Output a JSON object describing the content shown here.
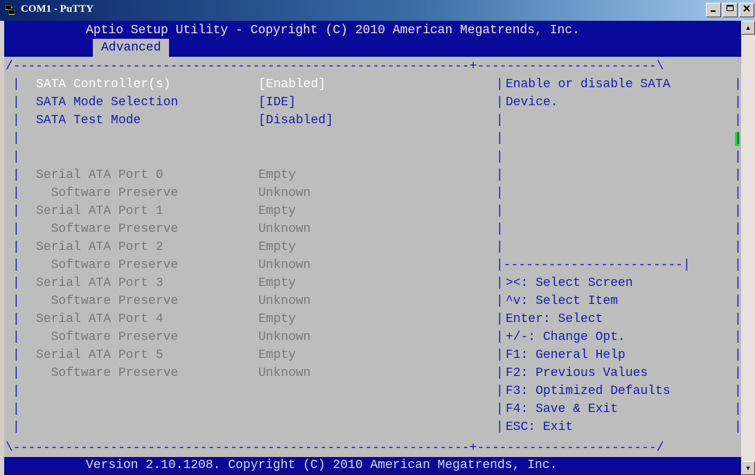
{
  "window": {
    "title": "COM1 - PuTTY"
  },
  "header": {
    "title_part1": "Aptio Setup Utility - Copyright (C) 2010 American Megatrends",
    "title_comma": ",",
    "title_part2": " Inc.",
    "tab": "Advanced"
  },
  "frame": {
    "top_border": "/-------------------------------------------------------------+------------------------\\",
    "bottom_border": "\\-------------------------------------------------------------+------------------------/",
    "help_separator": "|------------------------|"
  },
  "settings": [
    {
      "label": "SATA Controller(s)",
      "value": "[Enabled]"
    },
    {
      "label": "SATA Mode Selection",
      "value": "[IDE]"
    },
    {
      "label": "SATA Test Mode",
      "value": "[Disabled]"
    }
  ],
  "ports": [
    {
      "label": "Serial ATA Port 0",
      "value": "Empty"
    },
    {
      "label": "  Software Preserve",
      "value": "Unknown"
    },
    {
      "label": "Serial ATA Port 1",
      "value": "Empty"
    },
    {
      "label": "  Software Preserve",
      "value": "Unknown"
    },
    {
      "label": "Serial ATA Port 2",
      "value": "Empty"
    },
    {
      "label": "  Software Preserve",
      "value": "Unknown"
    },
    {
      "label": "Serial ATA Port 3",
      "value": "Empty"
    },
    {
      "label": "  Software Preserve",
      "value": "Unknown"
    },
    {
      "label": "Serial ATA Port 4",
      "value": "Empty"
    },
    {
      "label": "  Software Preserve",
      "value": "Unknown"
    },
    {
      "label": "Serial ATA Port 5",
      "value": "Empty"
    },
    {
      "label": "  Software Preserve",
      "value": "Unknown"
    }
  ],
  "help": {
    "description": [
      "Enable or disable SATA",
      "Device."
    ],
    "keys": [
      "><: Select Screen",
      "^v: Select Item",
      "Enter: Select",
      "+/-: Change Opt.",
      "F1: General Help",
      "F2: Previous Values",
      "F3: Optimized Defaults",
      "F4: Save & Exit",
      "ESC: Exit"
    ]
  },
  "footer": "Version 2.10.1208. Copyright (C) 2010 American Megatrends, Inc.",
  "colors": {
    "header_bg": "#0a0a9a",
    "terminal_bg": "#bdbdbd",
    "selected_text": "#ffffff",
    "item_text": "#1a1ab0",
    "info_text": "#777777",
    "cursor": "#22dd22"
  }
}
